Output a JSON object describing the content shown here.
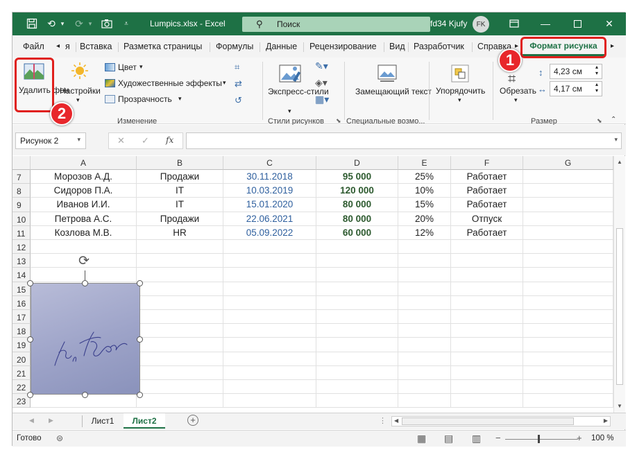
{
  "title_bar": {
    "file_name": "Lumpics.xlsx  -  Excel",
    "search_placeholder": "Поиск",
    "user_name": "fd34 Kjufy",
    "user_initials": "FK"
  },
  "ribbon_tabs": [
    "Файл",
    "я",
    "Вставка",
    "Разметка страницы",
    "Формулы",
    "Данные",
    "Рецензирование",
    "Вид",
    "Разработчик",
    "Справка"
  ],
  "active_tab": "Формат рисунка",
  "ribbon": {
    "remove_bg": "Удалить фон",
    "corrections": "Настройки",
    "color": "Цвет",
    "artistic": "Художественные эффекты",
    "transparency": "Прозрачность",
    "group_adjust": "Изменение",
    "quick_styles": "Экспресс-стили",
    "group_styles": "Стили рисунков",
    "alt_text": "Замещающий текст",
    "group_accessibility": "Специальные возмо...",
    "arrange": "Упорядочить",
    "crop": "Обрезать",
    "height": "4,23 см",
    "width": "4,17 см",
    "group_size": "Размер"
  },
  "annotations": {
    "badge1": "1",
    "badge2": "2"
  },
  "formula_bar": {
    "name_box": "Рисунок 2",
    "fx": "fx",
    "value": ""
  },
  "columns": [
    "A",
    "B",
    "C",
    "D",
    "E",
    "F",
    "G"
  ],
  "rows": [
    {
      "num": "7",
      "cells": [
        "Морозов А.Д.",
        "Продажи",
        "30.11.2018",
        "95 000",
        "25%",
        "Работает",
        ""
      ]
    },
    {
      "num": "8",
      "cells": [
        "Сидоров П.А.",
        "IT",
        "10.03.2019",
        "120 000",
        "10%",
        "Работает",
        ""
      ]
    },
    {
      "num": "9",
      "cells": [
        "Иванов И.И.",
        "IT",
        "15.01.2020",
        "80 000",
        "15%",
        "Работает",
        ""
      ]
    },
    {
      "num": "10",
      "cells": [
        "Петрова А.С.",
        "Продажи",
        "22.06.2021",
        "80 000",
        "20%",
        "Отпуск",
        ""
      ]
    },
    {
      "num": "11",
      "cells": [
        "Козлова М.В.",
        "HR",
        "05.09.2022",
        "60 000",
        "12%",
        "Работает",
        ""
      ]
    },
    {
      "num": "12",
      "cells": [
        "",
        "",
        "",
        "",
        "",
        "",
        ""
      ]
    },
    {
      "num": "13",
      "cells": [
        "",
        "",
        "",
        "",
        "",
        "",
        ""
      ]
    },
    {
      "num": "14",
      "cells": [
        "",
        "",
        "",
        "",
        "",
        "",
        ""
      ]
    },
    {
      "num": "15",
      "cells": [
        "",
        "",
        "",
        "",
        "",
        "",
        ""
      ]
    },
    {
      "num": "16",
      "cells": [
        "",
        "",
        "",
        "",
        "",
        "",
        ""
      ]
    },
    {
      "num": "17",
      "cells": [
        "",
        "",
        "",
        "",
        "",
        "",
        ""
      ]
    },
    {
      "num": "18",
      "cells": [
        "",
        "",
        "",
        "",
        "",
        "",
        ""
      ]
    },
    {
      "num": "19",
      "cells": [
        "",
        "",
        "",
        "",
        "",
        "",
        ""
      ]
    },
    {
      "num": "20",
      "cells": [
        "",
        "",
        "",
        "",
        "",
        "",
        ""
      ]
    },
    {
      "num": "21",
      "cells": [
        "",
        "",
        "",
        "",
        "",
        "",
        ""
      ]
    },
    {
      "num": "22",
      "cells": [
        "",
        "",
        "",
        "",
        "",
        "",
        ""
      ]
    },
    {
      "num": "23",
      "cells": [
        "",
        "",
        "",
        "",
        "",
        "",
        ""
      ]
    }
  ],
  "sheets": [
    "Лист1",
    "Лист2"
  ],
  "active_sheet": "Лист2",
  "status": {
    "ready": "Готово",
    "zoom": "100 %"
  },
  "colors": {
    "accent": "#1e7145",
    "annotation": "#e0201d",
    "date_text": "#2e5f9e",
    "money_text": "#2d5a2f"
  }
}
